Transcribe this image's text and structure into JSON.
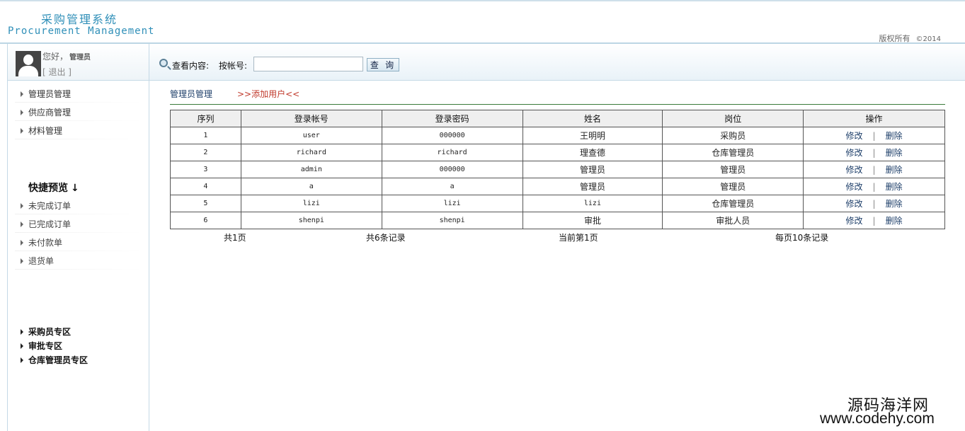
{
  "header": {
    "title_cn": "采购管理系统",
    "title_en": "Procurement Management",
    "copyright": "版权所有",
    "copyright_year": "©2014"
  },
  "user": {
    "greeting": "您好，",
    "name": "管理员",
    "logout": "[ 退出 ]"
  },
  "sidebar": {
    "items": [
      "管理员管理",
      "供应商管理",
      "材料管理"
    ],
    "quick_title": "快捷预览",
    "quick_arrow": "↓",
    "quick_items": [
      "未完成订单",
      "已完成订单",
      "未付款单",
      "退货单"
    ],
    "zones": [
      "采购员专区",
      "审批专区",
      "仓库管理员专区"
    ]
  },
  "search": {
    "label": "查看内容:",
    "by_label": "按帐号:",
    "value": "",
    "button": "查 询"
  },
  "content": {
    "breadcrumb": "管理员管理",
    "add_user": ">>添加用户<<",
    "columns": [
      "序列",
      "登录帐号",
      "登录密码",
      "姓名",
      "岗位",
      "操作"
    ],
    "rows": [
      {
        "id": "1",
        "account": "user",
        "password": "000000",
        "name": "王明明",
        "role": "采购员"
      },
      {
        "id": "2",
        "account": "richard",
        "password": "richard",
        "name": "理查德",
        "role": "仓库管理员"
      },
      {
        "id": "3",
        "account": "admin",
        "password": "000000",
        "name": "管理员",
        "role": "管理员"
      },
      {
        "id": "4",
        "account": "a",
        "password": "a",
        "name": "管理员",
        "role": "管理员"
      },
      {
        "id": "5",
        "account": "lizi",
        "password": "lizi",
        "name": "lizi",
        "role": "仓库管理员"
      },
      {
        "id": "6",
        "account": "shenpi",
        "password": "shenpi",
        "name": "审批",
        "role": "审批人员"
      }
    ],
    "op_edit": "修改",
    "op_sep": "|",
    "op_delete": "删除",
    "pager": {
      "total_pages": "共1页",
      "total_records": "共6条记录",
      "current_page": "当前第1页",
      "per_page": "每页10条记录"
    }
  },
  "watermark": {
    "cn": "源码海洋网",
    "url": "www.codehy.com"
  }
}
